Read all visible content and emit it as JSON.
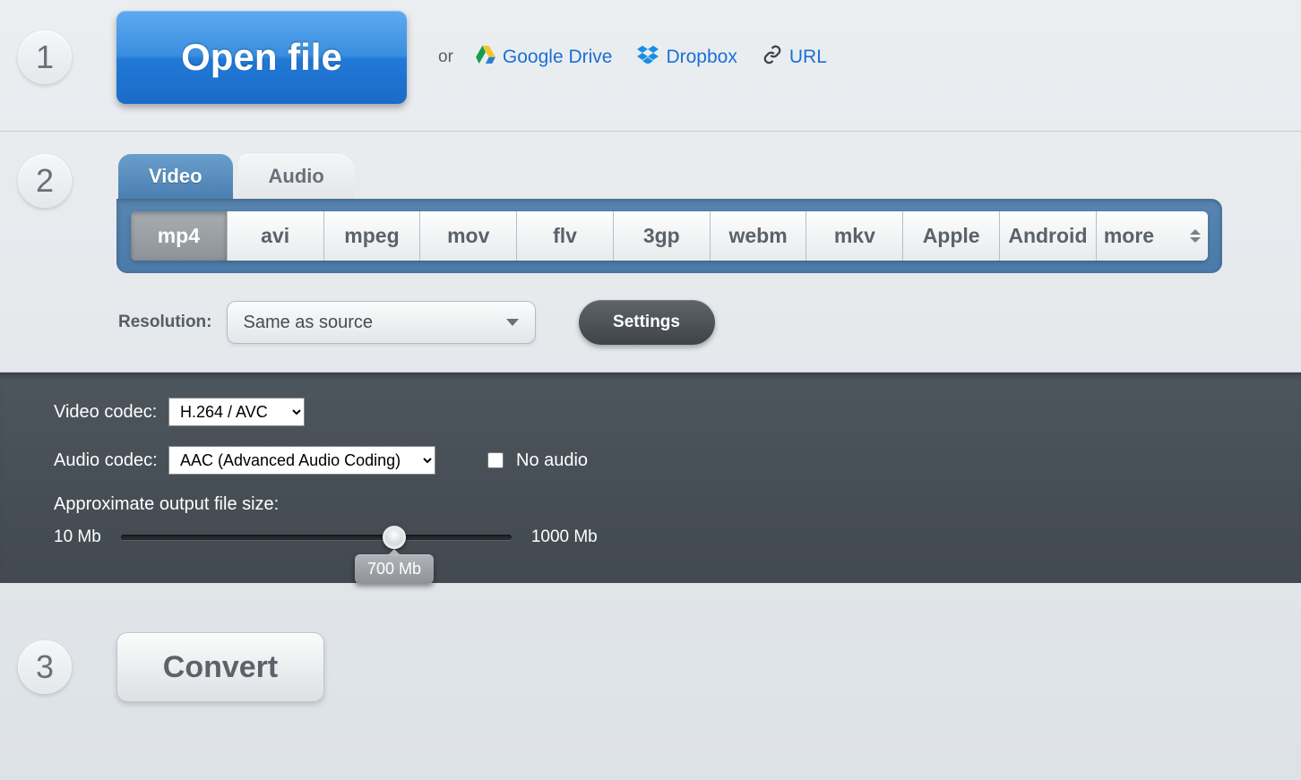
{
  "step1": {
    "number": "1",
    "open_file_label": "Open file",
    "or_text": "or",
    "sources": {
      "gdrive": "Google Drive",
      "dropbox": "Dropbox",
      "url": "URL"
    }
  },
  "step2": {
    "number": "2",
    "tabs": {
      "video": "Video",
      "audio": "Audio"
    },
    "formats": {
      "mp4": "mp4",
      "avi": "avi",
      "mpeg": "mpeg",
      "mov": "mov",
      "flv": "flv",
      "3gp": "3gp",
      "webm": "webm",
      "mkv": "mkv",
      "apple": "Apple",
      "android": "Android",
      "more": "more"
    },
    "resolution_label": "Resolution:",
    "resolution_value": "Same as source",
    "settings_label": "Settings"
  },
  "settings_panel": {
    "video_codec_label": "Video codec:",
    "video_codec_value": "H.264 / AVC",
    "audio_codec_label": "Audio codec:",
    "audio_codec_value": "AAC (Advanced Audio Coding)",
    "no_audio_label": "No audio",
    "approx_label": "Approximate output file size:",
    "slider_min_label": "10 Mb",
    "slider_max_label": "1000 Mb",
    "slider_value_label": "700 Mb"
  },
  "step3": {
    "number": "3",
    "convert_label": "Convert"
  }
}
